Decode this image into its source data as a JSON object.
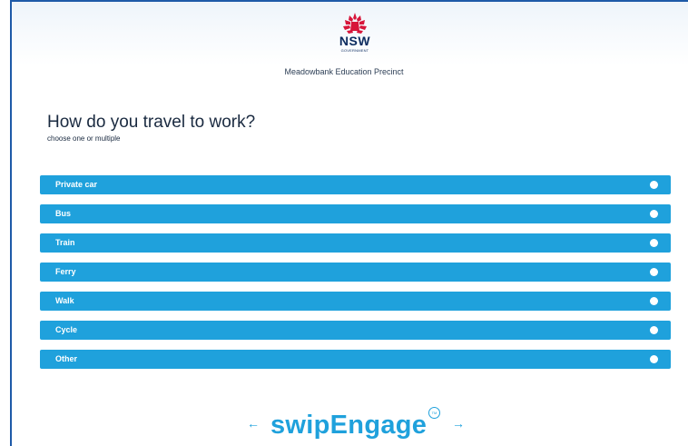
{
  "header": {
    "logo_text": "NSW",
    "logo_subtext": "GOVERNMENT",
    "precinct": "Meadowbank Education Precinct"
  },
  "survey": {
    "question": "How do you travel to work?",
    "hint": "choose one or multiple",
    "options": [
      {
        "label": "Private car",
        "selected": false
      },
      {
        "label": "Bus",
        "selected": false
      },
      {
        "label": "Train",
        "selected": false
      },
      {
        "label": "Ferry",
        "selected": false
      },
      {
        "label": "Walk",
        "selected": false
      },
      {
        "label": "Cycle",
        "selected": false
      },
      {
        "label": "Other",
        "selected": false
      }
    ]
  },
  "footer": {
    "brand": "swipEngage",
    "trademark": "TM",
    "prev_icon": "arrow-left-icon",
    "next_icon": "arrow-right-icon",
    "prev_glyph": "←",
    "next_glyph": "→"
  },
  "colors": {
    "accent": "#1fa1dc",
    "border": "#1e5aa8",
    "logo_red": "#d7153a",
    "logo_navy": "#0a2a5e"
  }
}
